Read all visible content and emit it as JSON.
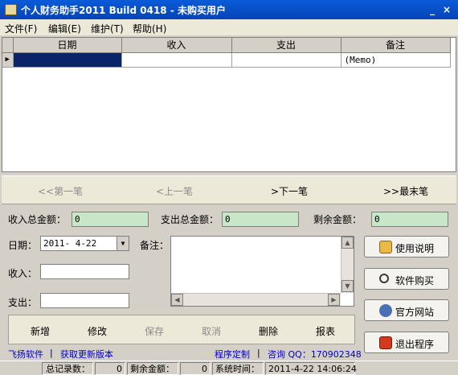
{
  "window": {
    "title": "个人财务助手2011 Build 0418 - 未购买用户",
    "minimize": "_",
    "close": "×"
  },
  "menu": [
    "文件(F)",
    "编辑(E)",
    "维护(T)",
    "帮助(H)"
  ],
  "grid": {
    "columns": [
      "日期",
      "收入",
      "支出",
      "备注"
    ],
    "rows": [
      {
        "date": "",
        "income": "",
        "expense": "",
        "memo": "(Memo)"
      }
    ]
  },
  "nav": {
    "first": "<<第一笔",
    "prev": "<上一笔",
    "next": ">下一笔",
    "last": ">>最末笔"
  },
  "totals": {
    "income_label": "收入总金额：",
    "income_value": "0",
    "expense_label": "支出总金额：",
    "expense_value": "0",
    "remain_label": "剩余金额：",
    "remain_value": "0"
  },
  "form": {
    "date_label": "日期：",
    "date_value": "2011- 4-22",
    "memo_label": "备注：",
    "income_label": "收入：",
    "expense_label": "支出："
  },
  "actions": {
    "add": "新增",
    "edit": "修改",
    "save": "保存",
    "cancel": "取消",
    "delete": "删除",
    "report": "报表"
  },
  "side": {
    "manual": "使用说明",
    "buy": "软件购买",
    "website": "官方网站",
    "exit": "退出程序"
  },
  "links": {
    "company": "飞扬软件",
    "update": "获取更新版本",
    "custom": "程序定制",
    "qq": "咨询 QQ：170902348"
  },
  "status": {
    "records_label": "总记录数：",
    "records_value": "0",
    "remain_label": "剩余金额：",
    "remain_value": "0",
    "time_label": "系统时间：",
    "time_value": "2011-4-22 14:06:24"
  },
  "colors": {
    "title_bar": "#0a5bd8",
    "total_field": "#c8e6c8",
    "link": "#0000c0",
    "selection": "#0a246a"
  }
}
